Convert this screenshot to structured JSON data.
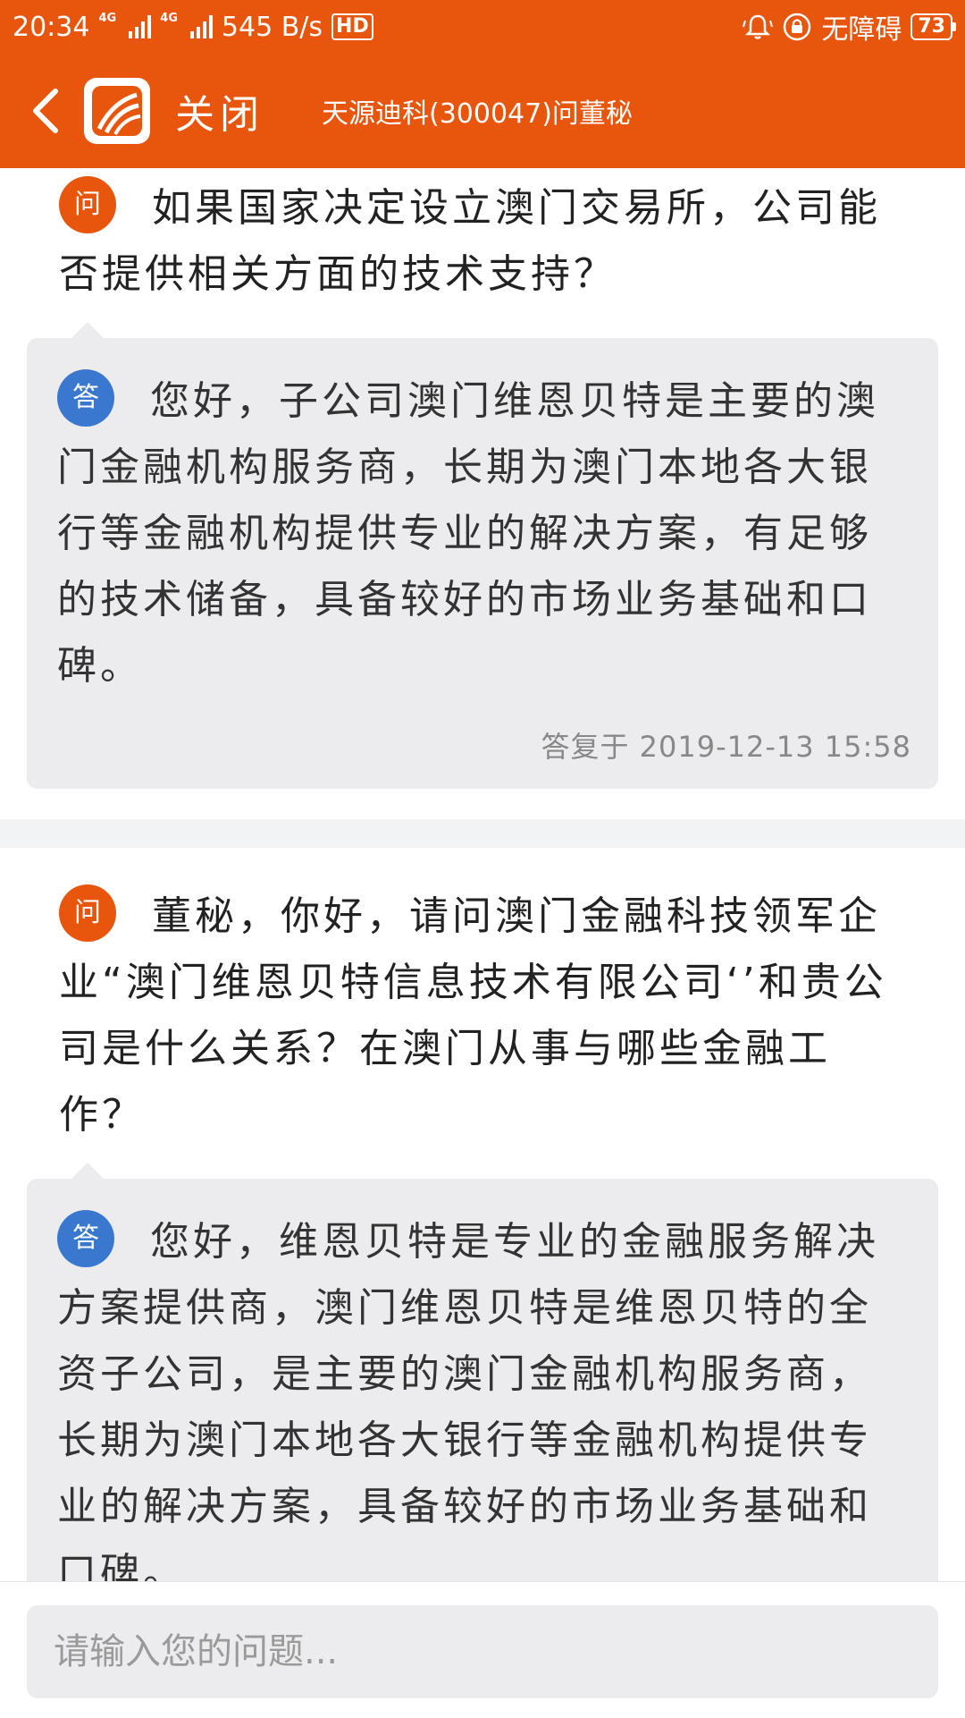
{
  "status_bar": {
    "time": "20:34",
    "network_tag_1": "4G",
    "network_tag_2": "4G",
    "speed": "545 B/s",
    "hd": "HD",
    "accessibility": "无障碍",
    "battery": "73"
  },
  "header": {
    "close_label": "关闭",
    "title": "天源迪科(300047)问董秘"
  },
  "qa": [
    {
      "q_badge": "问",
      "question": "如果国家决定设立澳门交易所，公司能否提供相关方面的技术支持？",
      "a_badge": "答",
      "answer": "您好，子公司澳门维恩贝特是主要的澳门金融机构服务商，长期为澳门本地各大银行等金融机构提供专业的解决方案，有足够的技术储备，具备较好的市场业务基础和口碑。",
      "answered_at": "答复于 2019-12-13 15:58"
    },
    {
      "q_badge": "问",
      "question": "董秘，你好，请问澳门金融科技领军企业“澳门维恩贝特信息技术有限公司‘’和贵公司是什么关系？在澳门从事与哪些金融工作？",
      "a_badge": "答",
      "answer": "您好，维恩贝特是专业的金融服务解决方案提供商，澳门维恩贝特是维恩贝特的全资子公司，是主要的澳门金融机构服务商，长期为澳门本地各大银行等金融机构提供专业的解决方案，具备较好的市场业务基础和口碑。",
      "answered_at": ""
    }
  ],
  "input": {
    "placeholder": "请输入您的问题..."
  },
  "colors": {
    "primary": "#e8550c",
    "answer_badge": "#3a78cf",
    "bubble": "#ececee"
  }
}
